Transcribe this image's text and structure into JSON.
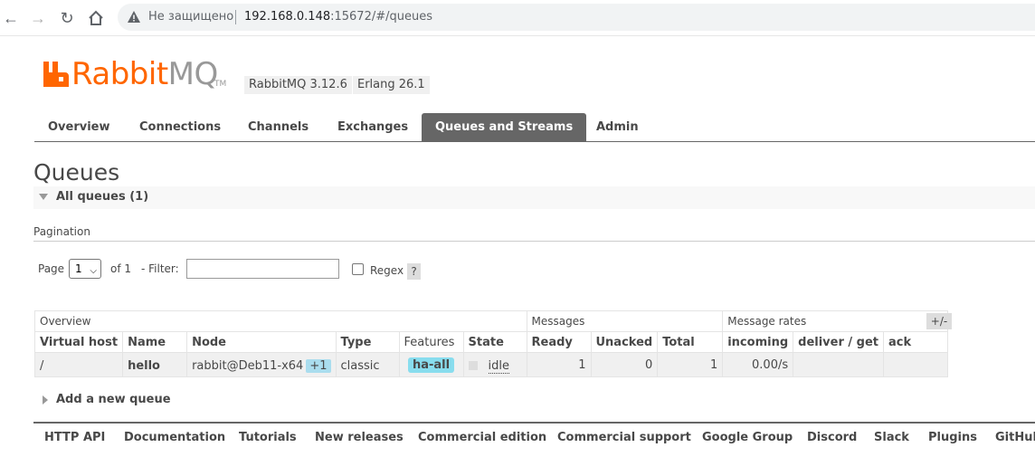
{
  "browser": {
    "back_icon": "arrow-left-icon",
    "forward_icon": "arrow-right-icon",
    "reload_icon": "reload-icon",
    "home_icon": "home-icon",
    "security_label": "Не защищено",
    "url_host": "192.168.0.148",
    "url_rest": ":15672/#/queues"
  },
  "header": {
    "logo_rabbit": "Rabbit",
    "logo_mq": "MQ",
    "logo_tm": "TM",
    "rabbitmq_version": "RabbitMQ 3.12.6",
    "erlang_version": "Erlang 26.1",
    "brand_color": "#ff6600"
  },
  "tabs": [
    {
      "label": "Overview"
    },
    {
      "label": "Connections"
    },
    {
      "label": "Channels"
    },
    {
      "label": "Exchanges"
    },
    {
      "label": "Queues and Streams",
      "active": true
    },
    {
      "label": "Admin"
    }
  ],
  "page": {
    "title": "Queues",
    "section_label": "All queues (1)"
  },
  "pagination": {
    "title": "Pagination",
    "page_label": "Page",
    "page_value": "1",
    "of_label": "of 1",
    "filter_label": "- Filter:",
    "filter_value": "",
    "regex_label": "Regex",
    "regex_checked": false,
    "help_label": "?"
  },
  "table": {
    "groups": {
      "overview": "Overview",
      "messages": "Messages",
      "rates": "Message rates"
    },
    "columns": {
      "vhost": "Virtual host",
      "name": "Name",
      "node": "Node",
      "type": "Type",
      "features": "Features",
      "state": "State",
      "ready": "Ready",
      "unacked": "Unacked",
      "total": "Total",
      "incoming": "incoming",
      "deliver_get": "deliver / get",
      "ack": "ack"
    },
    "rows": [
      {
        "vhost": "/",
        "name": "hello",
        "node": "rabbit@Deb11-x64",
        "node_extra": "+1",
        "type": "classic",
        "features": "ha-all",
        "state": "idle",
        "ready": "1",
        "unacked": "0",
        "total": "1",
        "incoming": "0.00/s",
        "deliver_get": "",
        "ack": ""
      }
    ],
    "columns_toggle": "+/-"
  },
  "add_queue": {
    "label": "Add a new queue"
  },
  "footer": {
    "links": [
      "HTTP API",
      "Documentation",
      "Tutorials",
      "New releases",
      "Commercial edition",
      "Commercial support",
      "Google Group",
      "Discord",
      "Slack",
      "Plugins",
      "GitHub"
    ]
  }
}
